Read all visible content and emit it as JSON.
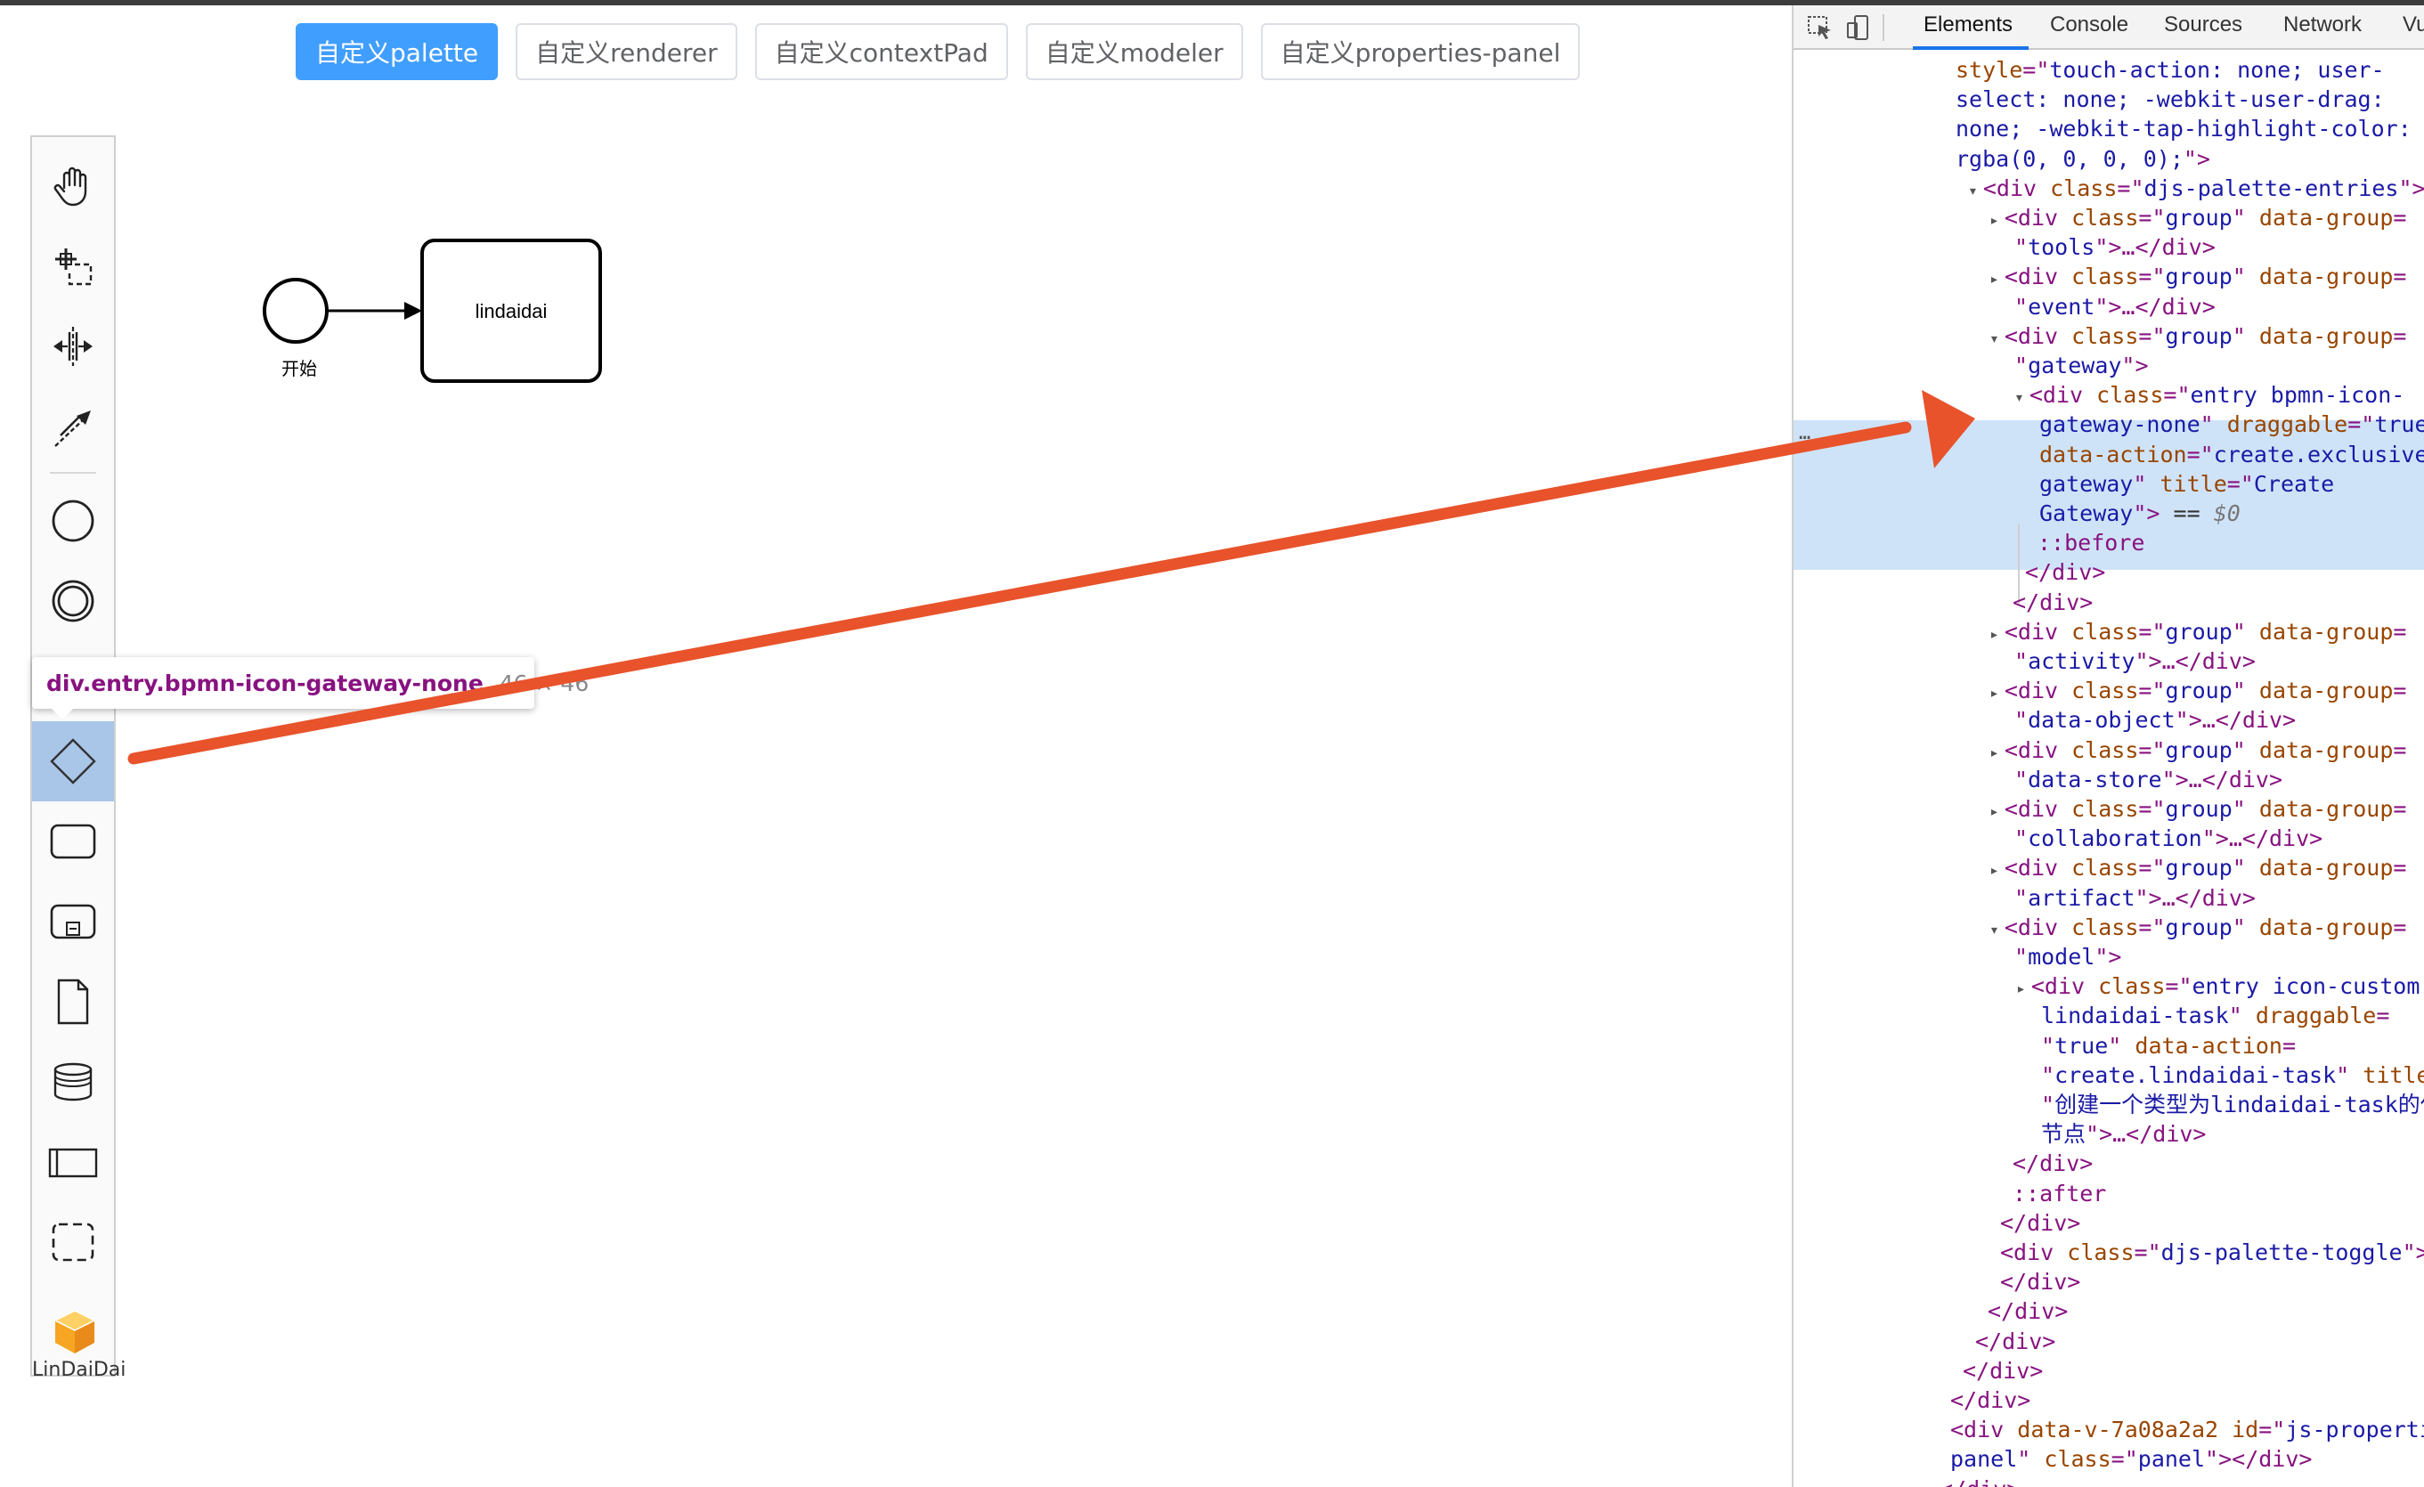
{
  "toolbar": {
    "buttons": [
      "自定义palette",
      "自定义renderer",
      "自定义contextPad",
      "自定义modeler",
      "自定义properties-panel"
    ],
    "active_index": 0
  },
  "palette": {
    "tools": [
      "hand-tool",
      "lasso-tool",
      "space-tool",
      "global-connect-tool"
    ],
    "entries": [
      "start-event",
      "intermediate-event",
      "end-event",
      "exclusive-gateway",
      "task",
      "subprocess",
      "data-object",
      "data-store",
      "participant",
      "group"
    ],
    "selected": "exclusive-gateway",
    "logo_text": "LinDaiDai"
  },
  "tooltip": {
    "selector": "div.entry.bpmn-icon-gateway-none",
    "size": "46 × 46"
  },
  "diagram": {
    "start_event_label": "开始",
    "task_label": "lindaidai"
  },
  "devtools": {
    "tabs": [
      "Elements",
      "Console",
      "Sources",
      "Network",
      "Vu"
    ],
    "active_tab": "Elements",
    "ellipsis": "…",
    "lines": [
      {
        "id": "l0",
        "html": "<span class=\"an\">style</span><span class=\"tag\">=\"</span><span class=\"av\">touch-action: none; user-</span>"
      },
      {
        "id": "l1",
        "html": "<span class=\"av\">select: none; -webkit-user-drag:</span>"
      },
      {
        "id": "l2",
        "html": "<span class=\"av\">none; -webkit-tap-highlight-color:</span>"
      },
      {
        "id": "l3",
        "html": "<span class=\"av\">rgba(0, 0, 0, 0);</span><span class=\"tag\">\"&gt;</span>"
      }
    ]
  },
  "colors": {
    "primary_button": "#409eff",
    "selection": "#a9c6e8",
    "devtools_highlight": "#cfe3f8",
    "arrow": "#e8532b"
  }
}
